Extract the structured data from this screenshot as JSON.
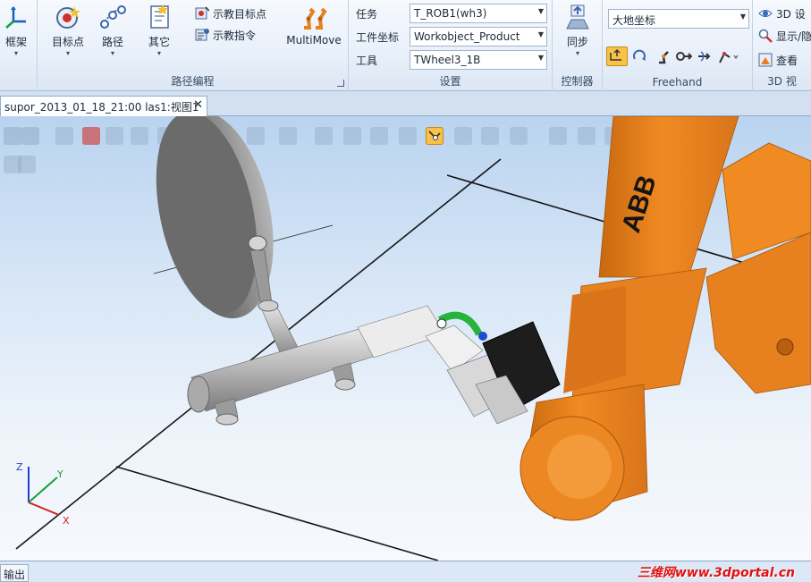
{
  "ribbon": {
    "partial_left_button": "框架",
    "path_group": {
      "title": "路径编程",
      "target_button": "目标点",
      "path_button": "路径",
      "other_button": "其它",
      "teach_target": "示教目标点",
      "teach_instruction": "示教指令",
      "multimove": "MultiMove"
    },
    "settings_group": {
      "title": "设置",
      "task_label": "任务",
      "task_value": "T_ROB1(wh3)",
      "wobj_label": "工件坐标",
      "wobj_value": "Workobject_Product",
      "tool_label": "工具",
      "tool_value": "TWheel3_1B"
    },
    "controller_group": {
      "title": "控制器",
      "sync_button": "同步"
    },
    "freehand_group": {
      "title": "Freehand",
      "frame_value": "大地坐标"
    },
    "view3d_group": {
      "title": "3D 视",
      "settings": "3D 设",
      "show_hide": "显示/隐",
      "view": "查看"
    }
  },
  "document_tab": {
    "title": "supor_2013_01_18_21:00  las1:视图1",
    "close": "✕"
  },
  "viewport": {
    "robot_brand": "ABB",
    "axes": {
      "z": "Z",
      "y": "Y",
      "x": "X"
    }
  },
  "output": {
    "tab_label": "输出",
    "watermark": "三维网www.3dportal.cn"
  },
  "colors": {
    "robot_orange": "#e7811f",
    "robot_shadow": "#b85f10",
    "part_grey": "#b8b8b8",
    "gripper_green": "#27b43a",
    "watermark_red": "#e01010"
  }
}
